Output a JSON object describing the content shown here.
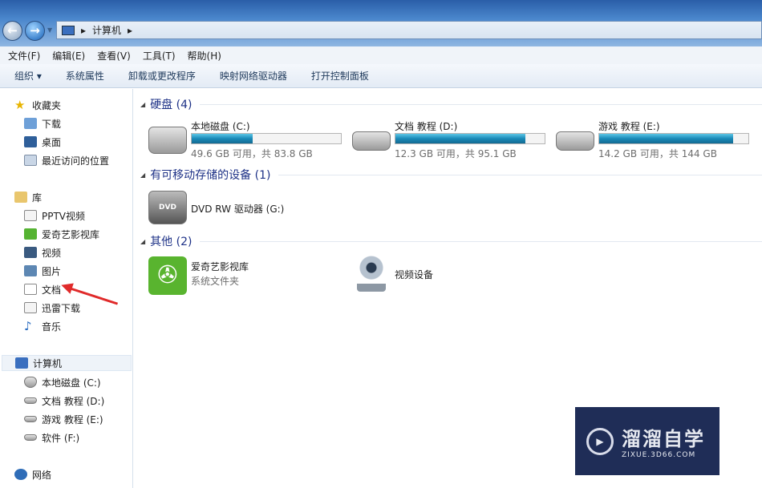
{
  "address": {
    "path": "计算机"
  },
  "menu": [
    "文件(F)",
    "编辑(E)",
    "查看(V)",
    "工具(T)",
    "帮助(H)"
  ],
  "toolbar": {
    "organize": "组织 ▾",
    "items": [
      "系统属性",
      "卸载或更改程序",
      "映射网络驱动器",
      "打开控制面板"
    ]
  },
  "sidebar": {
    "favorites": {
      "label": "收藏夹",
      "items": [
        "下载",
        "桌面",
        "最近访问的位置"
      ]
    },
    "libraries": {
      "label": "库",
      "items": [
        "PPTV视频",
        "爱奇艺影视库",
        "视频",
        "图片",
        "文档",
        "迅雷下载",
        "音乐"
      ]
    },
    "computer": {
      "label": "计算机",
      "items": [
        "本地磁盘 (C:)",
        "文档  教程 (D:)",
        "游戏  教程 (E:)",
        "软件 (F:)"
      ]
    },
    "network": {
      "label": "网络"
    }
  },
  "groups": {
    "hdd": {
      "label": "硬盘 (4)",
      "drives": [
        {
          "name": "本地磁盘 (C:)",
          "capacity": "49.6 GB 可用，共 83.8 GB",
          "used_pct": 41
        },
        {
          "name": "文档  教程 (D:)",
          "capacity": "12.3 GB 可用，共 95.1 GB",
          "used_pct": 87
        },
        {
          "name": "游戏  教程 (E:)",
          "capacity": "14.2 GB 可用，共 144 GB",
          "used_pct": 90
        }
      ]
    },
    "removable": {
      "label": "有可移动存储的设备 (1)",
      "dvd": {
        "name": "DVD RW 驱动器 (G:)",
        "badge": "DVD"
      }
    },
    "other": {
      "label": "其他 (2)",
      "items": [
        {
          "name": "爱奇艺影视库",
          "sub": "系统文件夹"
        },
        {
          "name": "视频设备"
        }
      ]
    }
  },
  "watermark": {
    "title": "溜溜自学",
    "url": "ZIXUE.3D66.COM"
  },
  "colors": {
    "accent": "#1a8ab8",
    "arrow": "#e02a2a",
    "watermark_bg": "#1f2d57"
  }
}
